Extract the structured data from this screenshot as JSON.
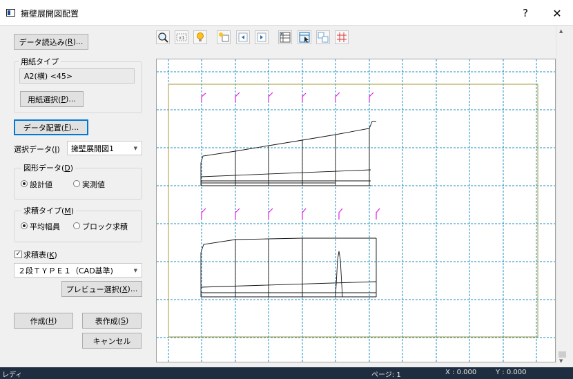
{
  "window": {
    "title": "擁壁展開図配置",
    "help": "?",
    "close": "✕"
  },
  "left": {
    "read_data_btn": {
      "pre": "データ読込み(",
      "key": "R",
      "post": ")..."
    },
    "paper_type": {
      "legend": "用紙タイプ",
      "value": "A2(横) <45>",
      "select_btn": {
        "pre": "用紙選択(",
        "key": "P",
        "post": ")..."
      }
    },
    "data_layout_btn": {
      "pre": "データ配置(",
      "key": "F",
      "post": ")..."
    },
    "select_data": {
      "label_pre": "選択データ(",
      "key": "I",
      "label_post": ")",
      "value": "擁壁展開図1"
    },
    "figure_data": {
      "legend_pre": "図形データ(",
      "key": "D",
      "legend_post": ")",
      "options": [
        "設計値",
        "実測値"
      ],
      "selected": 0
    },
    "calc_type": {
      "legend_pre": "求積タイプ(",
      "key": "M",
      "legend_post": ")",
      "options": [
        "平均幅員",
        "ブロック求積"
      ],
      "selected": 0
    },
    "calc_table": {
      "label_pre": "求積表(",
      "key": "K",
      "label_post": ")",
      "checked": true,
      "check_mark": "✓",
      "value": "２段ＴＹＰＥ１（CAD基準)"
    },
    "preview_select_btn": {
      "pre": "プレビュー選択(",
      "key": "X",
      "post": ")..."
    },
    "create_btn": {
      "pre": "作成(",
      "key": "H",
      "post": ")"
    },
    "table_create_btn": {
      "pre": "表作成(",
      "key": "S",
      "post": ")"
    },
    "cancel_btn": "キャンセル"
  },
  "toolbar": [
    "zoom-icon",
    "fit-icon",
    "light-icon",
    "move-icon",
    "prev-icon",
    "next-icon",
    "table-icon",
    "select-icon",
    "copy-icon",
    "grid-icon"
  ],
  "status": {
    "left": "レディ",
    "page": "ページ: 1",
    "x": "X : 0.000",
    "y": "Y : 0.000"
  },
  "colors": {
    "accent": "#0078d7",
    "grid": "#1a8cbf",
    "frame": "#a89a3a",
    "marker": "#e020e0",
    "status_bg": "#1e2d40"
  }
}
